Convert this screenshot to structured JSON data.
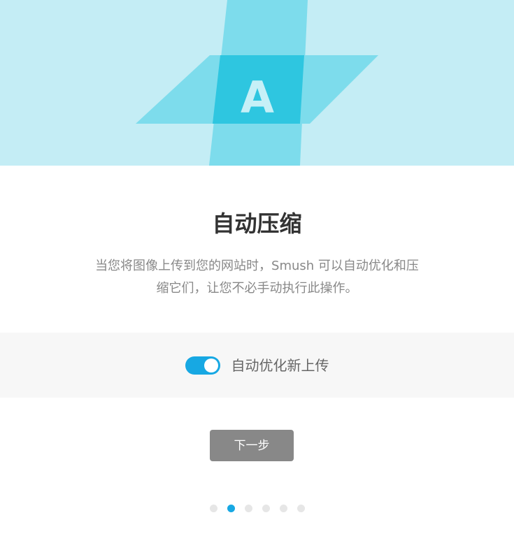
{
  "hero": {
    "letter": "A",
    "icon": "auto-compress-icon",
    "colors": {
      "background": "#c4edf5",
      "shape_light": "#7ddcec",
      "shape_dark": "#2ec6e0",
      "letter": "#c6f0f7"
    }
  },
  "content": {
    "title": "自动压缩",
    "description": "当您将图像上传到您的网站时，Smush 可以自动优化和压缩它们，让您不必手动执行此操作。"
  },
  "setting": {
    "label": "自动优化新上传",
    "enabled": true
  },
  "actions": {
    "next_label": "下一步"
  },
  "pagination": {
    "total": 6,
    "current": 2
  },
  "colors": {
    "accent": "#17a8e3",
    "button": "#888888",
    "text_primary": "#333333",
    "text_secondary": "#888888"
  }
}
